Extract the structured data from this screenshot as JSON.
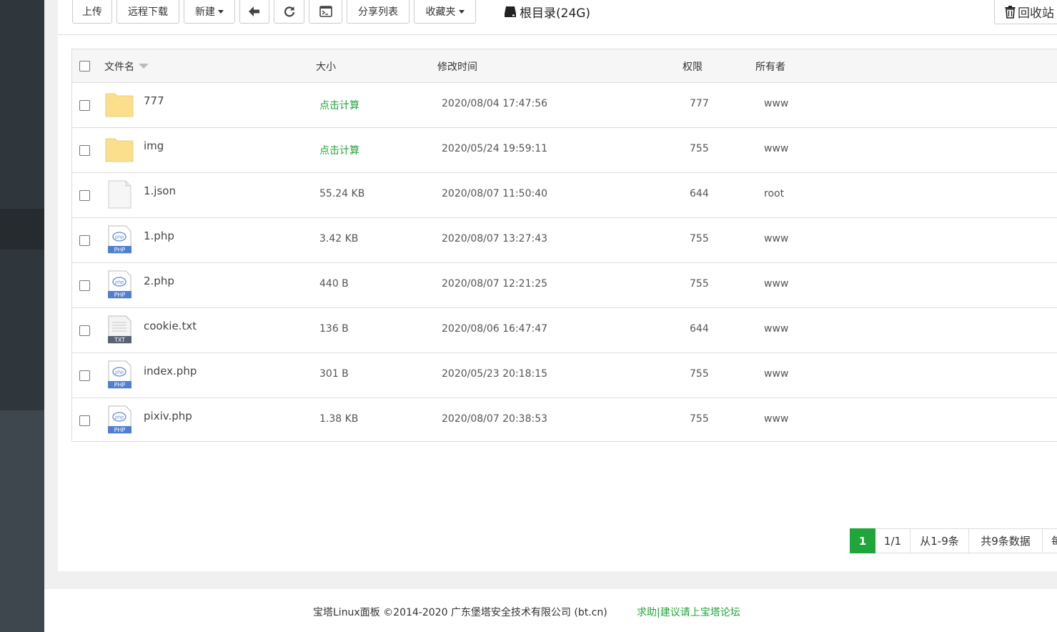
{
  "toolbar": {
    "upload": "上传",
    "remote_download": "远程下载",
    "new": "新建",
    "share_list": "分享列表",
    "favorites": "收藏夹",
    "dir_label": "根目录(24G)",
    "recycle": "回收站"
  },
  "table": {
    "headers": {
      "name": "文件名",
      "size": "大小",
      "mtime": "修改时间",
      "perm": "权限",
      "owner": "所有者"
    },
    "rows": [
      {
        "name": "777",
        "type": "folder",
        "size": "点击计算",
        "mtime": "2020/08/04 17:47:56",
        "perm": "777",
        "owner": "www"
      },
      {
        "name": "img",
        "type": "folder",
        "size": "点击计算",
        "mtime": "2020/05/24 19:59:11",
        "perm": "755",
        "owner": "www"
      },
      {
        "name": "1.json",
        "type": "file",
        "size": "55.24 KB",
        "mtime": "2020/08/07 11:50:40",
        "perm": "644",
        "owner": "root"
      },
      {
        "name": "1.php",
        "type": "php",
        "size": "3.42 KB",
        "mtime": "2020/08/07 13:27:43",
        "perm": "755",
        "owner": "www"
      },
      {
        "name": "2.php",
        "type": "php",
        "size": "440 B",
        "mtime": "2020/08/07 12:21:25",
        "perm": "755",
        "owner": "www"
      },
      {
        "name": "cookie.txt",
        "type": "txt",
        "size": "136 B",
        "mtime": "2020/08/06 16:47:47",
        "perm": "644",
        "owner": "www"
      },
      {
        "name": "index.php",
        "type": "php",
        "size": "301 B",
        "mtime": "2020/05/23 20:18:15",
        "perm": "755",
        "owner": "www"
      },
      {
        "name": "pixiv.php",
        "type": "php",
        "size": "1.38 KB",
        "mtime": "2020/08/07 20:38:53",
        "perm": "755",
        "owner": "www"
      }
    ]
  },
  "icon_labels": {
    "php": "PHP",
    "txt": "TXT"
  },
  "pagination": {
    "current": "1",
    "pages": "1/1",
    "range": "从1-9条",
    "total": "共9条数据",
    "per_page": "每"
  },
  "footer": {
    "copyright": "宝塔Linux面板 ©2014-2020 广东堡塔安全技术有限公司 (bt.cn)",
    "help_link": "求助|建议请上宝塔论坛"
  },
  "colors": {
    "accent": "#20a53a",
    "sidebar": "#2f363c"
  }
}
